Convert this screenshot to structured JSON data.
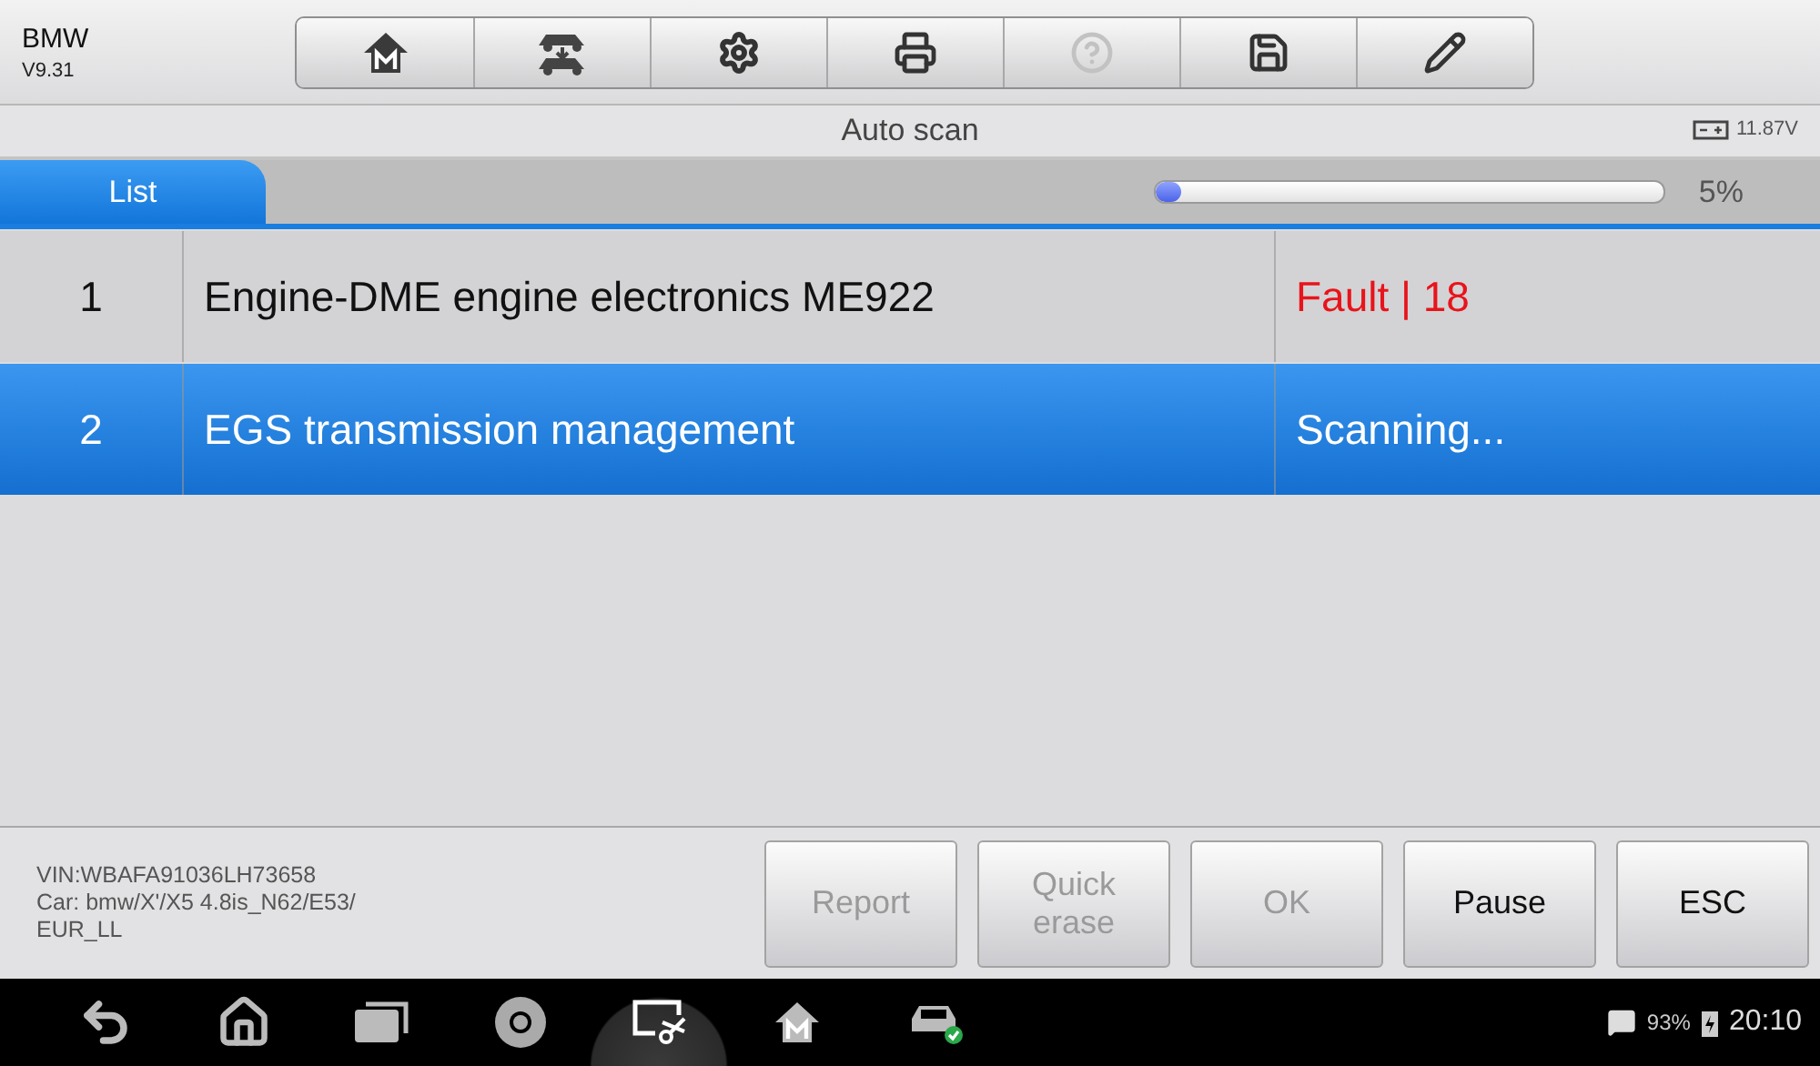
{
  "header": {
    "brand": "BMW",
    "version": "V9.31"
  },
  "toolbar": [
    {
      "kind": "home-m",
      "disabled": false
    },
    {
      "kind": "cars",
      "disabled": false
    },
    {
      "kind": "settings",
      "disabled": false
    },
    {
      "kind": "print",
      "disabled": false
    },
    {
      "kind": "help",
      "disabled": true
    },
    {
      "kind": "save",
      "disabled": false
    },
    {
      "kind": "edit",
      "disabled": false
    }
  ],
  "title_bar": {
    "title": "Auto scan",
    "voltage": "11.87V"
  },
  "tabs": [
    {
      "label": "List",
      "selected": true
    }
  ],
  "progress": {
    "level": 0.05,
    "reading": "5%"
  },
  "rows": [
    {
      "number": "1",
      "name": "Engine-DME engine electronics ME922",
      "status": "Fault | 18",
      "fault": true,
      "selected": false
    },
    {
      "number": "2",
      "name": "EGS transmission management",
      "status": "Scanning...",
      "fault": false,
      "selected": true
    }
  ],
  "vehicle_info": [
    "VIN:WBAFA91036LH73658",
    "Car: bmw/X'/X5 4.8is_N62/E53/",
    "EUR_LL"
  ],
  "buttons": [
    {
      "label": "Report",
      "disabled": true
    },
    {
      "label": "Quick erase",
      "disabled": true
    },
    {
      "label": "OK",
      "disabled": true
    },
    {
      "label": "Pause",
      "disabled": false
    },
    {
      "label": "ESC",
      "disabled": false
    }
  ],
  "nav_bar": [
    {
      "kind": "back",
      "selected": false
    },
    {
      "kind": "home",
      "selected": false
    },
    {
      "kind": "recents",
      "selected": false
    },
    {
      "kind": "browser",
      "selected": false
    },
    {
      "kind": "screenshot",
      "selected": true
    },
    {
      "kind": "home-m",
      "selected": false
    },
    {
      "kind": "car",
      "selected": false
    }
  ],
  "status_bar": {
    "battery": "93%",
    "time": "20:10"
  }
}
